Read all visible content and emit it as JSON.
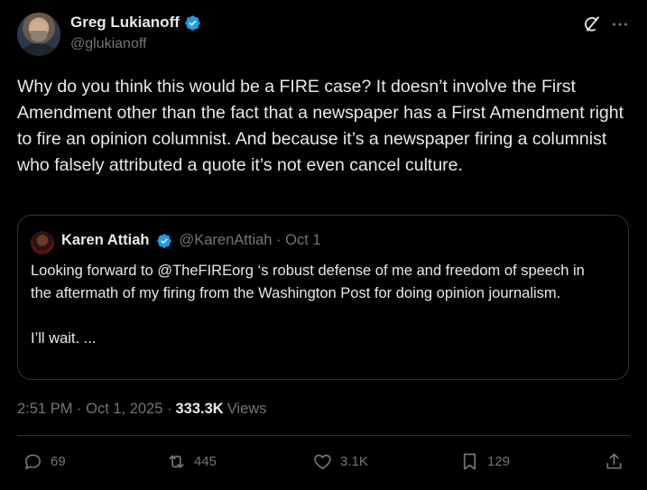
{
  "author": {
    "display_name": "Greg Lukianoff",
    "handle": "@glukianoff"
  },
  "tweet": {
    "text": "Why do you think this would be a FIRE case? It doesn’t involve the First Amendment other than the fact that a newspaper has a First Amendment right to fire an opinion columnist. And because it’s a newspaper firing a columnist who falsely attributed a quote it’s not even cancel culture."
  },
  "quoted_tweet": {
    "display_name": "Karen Attiah",
    "handle_date": "@KarenAttiah · Oct 1",
    "text": "Looking forward to @TheFIREorg ‘s robust defense of me and freedom of speech in the aftermath of my firing from the Washington Post for doing opinion journalism.\n\nI’ll wait. ..."
  },
  "meta": {
    "time_date": "2:51 PM · Oct 1, 2025 ·",
    "views_count": "333.3K",
    "views_label": "Views"
  },
  "actions": {
    "replies": "69",
    "reposts": "445",
    "likes": "3.1K",
    "bookmarks": "129"
  },
  "colors": {
    "background": "#000000",
    "text": "#e7e9ea",
    "secondary": "#71767b",
    "border": "#2f3336",
    "verified": "#1d9bf0"
  }
}
